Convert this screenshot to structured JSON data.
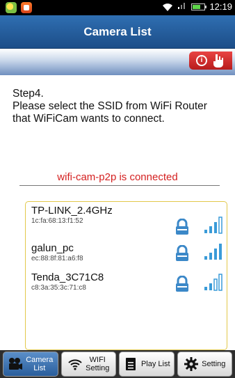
{
  "status_bar": {
    "time": "12:19"
  },
  "header": {
    "title": "Camera List"
  },
  "help": {
    "icon": "info-hand-icon"
  },
  "instructions": {
    "line1": "Step4.",
    "line2": "Please select the SSID from WiFi Router that WiFiCam wants to connect."
  },
  "connection": {
    "status": "wifi-cam-p2p is connected",
    "color": "#d42020"
  },
  "networks": [
    {
      "ssid": "TP-LINK_2.4GHz",
      "mac": "1c:fa:68:13:f1:52",
      "locked": true,
      "signal": 3
    },
    {
      "ssid": "galun_pc",
      "mac": "ec:88:8f:81:a6:f8",
      "locked": true,
      "signal": 4
    },
    {
      "ssid": "Tenda_3C71C8",
      "mac": "c8:3a:35:3c:71:c8",
      "locked": true,
      "signal": 2
    }
  ],
  "bottom_nav": [
    {
      "label_line1": "Camera",
      "label_line2": "List",
      "icon": "camera-icon",
      "active": true
    },
    {
      "label_line1": "WIFI",
      "label_line2": "Setting",
      "icon": "wifi-icon",
      "active": false
    },
    {
      "label_line1": "Play List",
      "label_line2": "",
      "icon": "document-icon",
      "active": false
    },
    {
      "label_line1": "Setting",
      "label_line2": "",
      "icon": "gear-icon",
      "active": false
    }
  ],
  "colors": {
    "accent": "#2f6fb2",
    "signal": "#3a9bd8",
    "lock": "#3b88c8"
  }
}
